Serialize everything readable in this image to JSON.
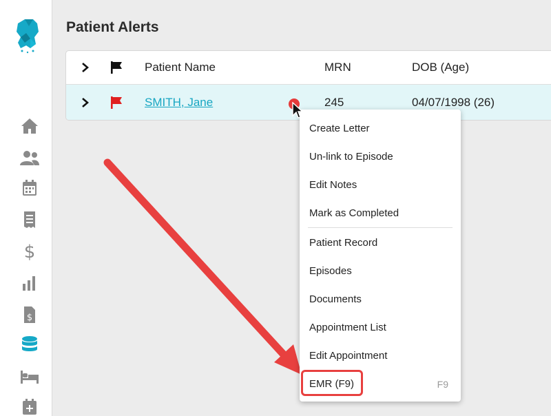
{
  "page": {
    "title": "Patient Alerts"
  },
  "table": {
    "headers": {
      "name": "Patient Name",
      "mrn": "MRN",
      "dob": "DOB (Age)"
    },
    "rows": [
      {
        "name": "SMITH, Jane",
        "mrn": "245",
        "dob": "04/07/1998 (26)",
        "flag_color": "#e02020"
      }
    ]
  },
  "sidebar": {
    "items": [
      {
        "icon": "home-icon"
      },
      {
        "icon": "users-icon"
      },
      {
        "icon": "calendar-icon"
      },
      {
        "icon": "receipt-icon"
      },
      {
        "icon": "dollar-icon"
      },
      {
        "icon": "bar-chart-icon"
      },
      {
        "icon": "invoice-icon"
      },
      {
        "icon": "database-icon",
        "active": true
      },
      {
        "icon": "bed-icon"
      },
      {
        "icon": "calendar-plus-icon"
      }
    ],
    "accent_color": "#16a9c7"
  },
  "context_menu": {
    "items": [
      {
        "label": "Create Letter"
      },
      {
        "label": "Un-link to Episode"
      },
      {
        "label": "Edit Notes"
      },
      {
        "label": "Mark as Completed"
      },
      {
        "label": "Patient Record"
      },
      {
        "label": "Episodes"
      },
      {
        "label": "Documents"
      },
      {
        "label": "Appointment List"
      },
      {
        "label": "Edit Appointment"
      },
      {
        "label": "EMR (F9)",
        "shortcut": "F9"
      }
    ]
  },
  "annotation_color": "#e8403f"
}
